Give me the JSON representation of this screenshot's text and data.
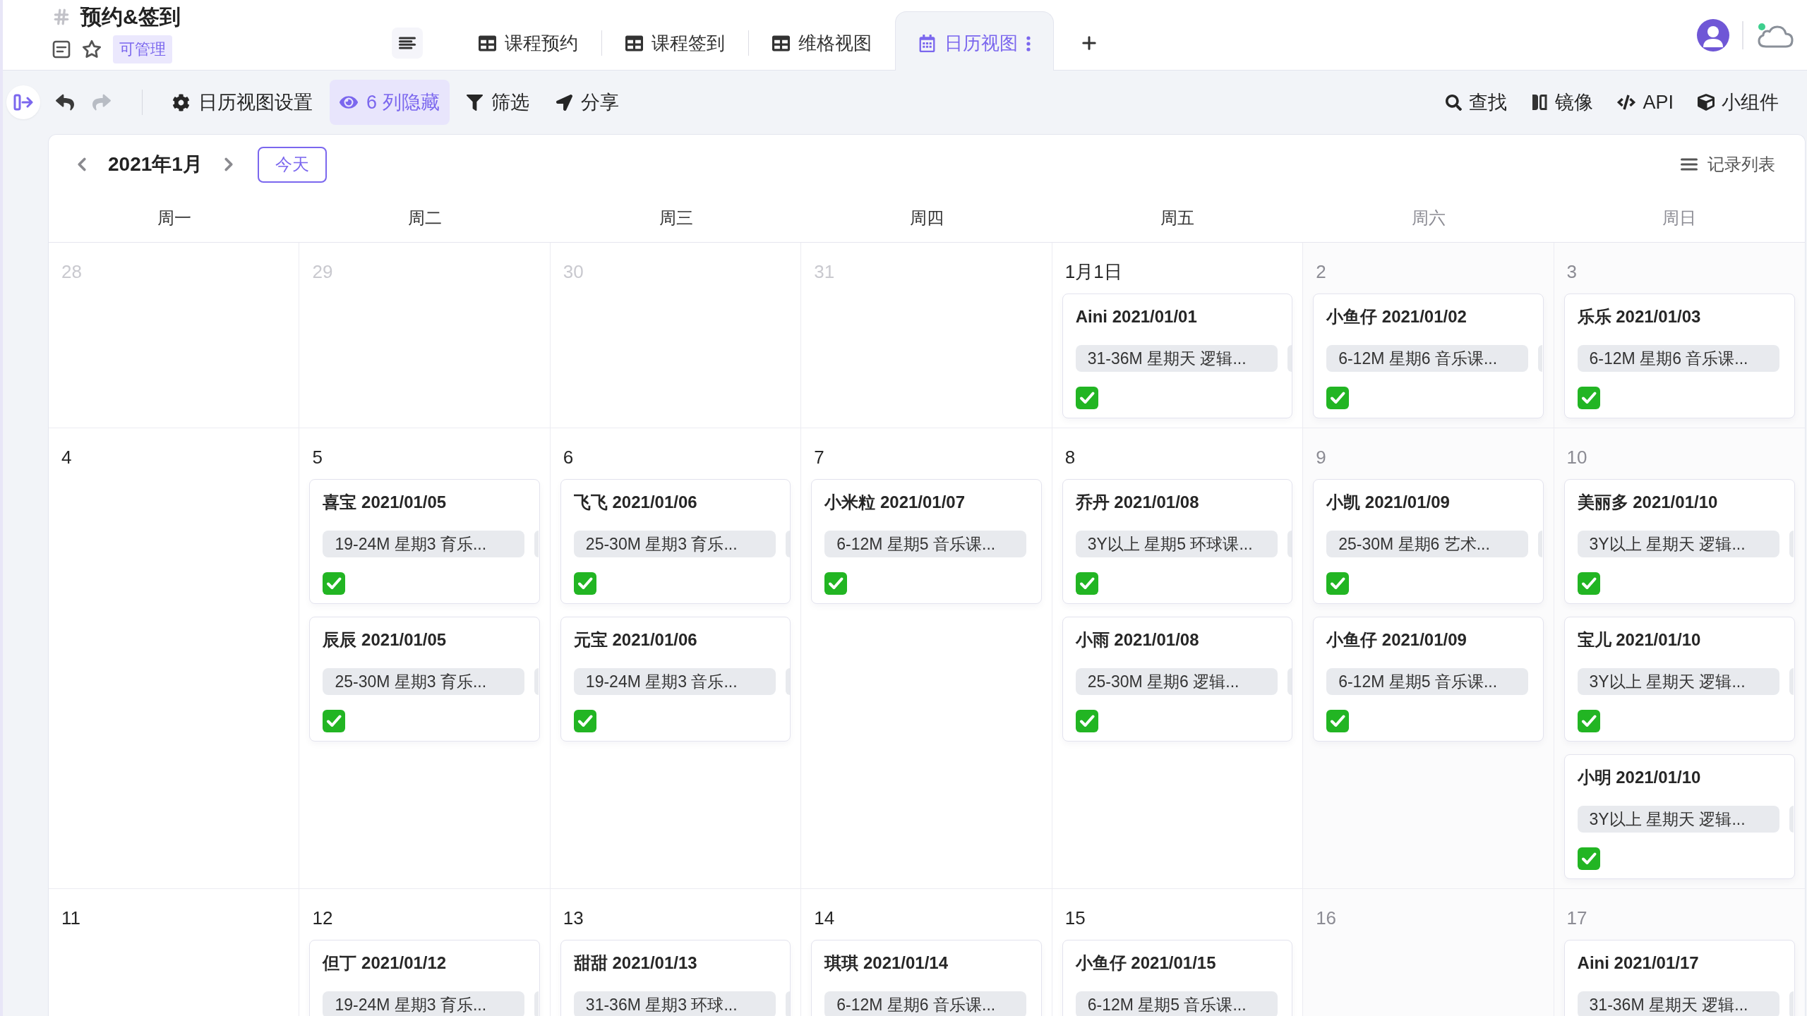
{
  "header": {
    "title": "预约&签到",
    "starred": false,
    "badge": "可管理"
  },
  "tabs": [
    {
      "label": "课程预约",
      "kind": "grid",
      "selected": false
    },
    {
      "label": "课程签到",
      "kind": "grid",
      "selected": false
    },
    {
      "label": "维格视图",
      "kind": "grid",
      "selected": false
    },
    {
      "label": "日历视图",
      "kind": "calendar",
      "selected": true
    }
  ],
  "toolbar": {
    "history": [
      {
        "kind": "undo",
        "disabled": false
      },
      {
        "kind": "redo",
        "disabled": true
      }
    ],
    "tools": [
      {
        "label": "日历视图设置",
        "kind": "settings",
        "active": false
      },
      {
        "label": "6 列隐藏",
        "kind": "hidden_columns",
        "active": true
      },
      {
        "label": "筛选",
        "kind": "filter",
        "active": false
      },
      {
        "label": "分享",
        "kind": "share",
        "active": false
      }
    ],
    "actions": [
      {
        "label": "查找",
        "kind": "search"
      },
      {
        "label": "镜像",
        "kind": "mirror"
      },
      {
        "label": "API",
        "kind": "api"
      },
      {
        "label": "小组件",
        "kind": "widget"
      }
    ]
  },
  "calendar": {
    "month": "2021年1月",
    "today_button": "今天",
    "record_list": "记录列表",
    "weekdays": [
      {
        "label": "周一",
        "weekend": false
      },
      {
        "label": "周二",
        "weekend": false
      },
      {
        "label": "周三",
        "weekend": false
      },
      {
        "label": "周四",
        "weekend": false
      },
      {
        "label": "周五",
        "weekend": false
      },
      {
        "label": "周六",
        "weekend": true
      },
      {
        "label": "周日",
        "weekend": true
      }
    ],
    "weeks": [
      {
        "days": [
          {
            "label": "28",
            "in_month": false
          },
          {
            "label": "29",
            "in_month": false
          },
          {
            "label": "30",
            "in_month": false
          },
          {
            "label": "31",
            "in_month": false
          },
          {
            "label": "1月1日",
            "in_month": true,
            "events": [
              {
                "title": "Aini 2021/01/01",
                "tag": "31-36M 星期天 逻辑...",
                "more_tags": true,
                "checked": true
              }
            ]
          },
          {
            "label": "2",
            "in_month": true,
            "events": [
              {
                "title": "小鱼仔 2021/01/02",
                "tag": "6-12M 星期6 音乐课...",
                "more_tags": true,
                "checked": true
              }
            ]
          },
          {
            "label": "3",
            "in_month": true,
            "events": [
              {
                "title": "乐乐 2021/01/03",
                "tag": "6-12M 星期6 音乐课...",
                "more_tags": false,
                "checked": true
              }
            ]
          }
        ]
      },
      {
        "days": [
          {
            "label": "4",
            "in_month": true
          },
          {
            "label": "5",
            "in_month": true,
            "events": [
              {
                "title": "喜宝 2021/01/05",
                "tag": "19-24M 星期3 育乐...",
                "more_tags": true,
                "checked": true
              },
              {
                "title": "辰辰 2021/01/05",
                "tag": "25-30M 星期3 育乐...",
                "more_tags": true,
                "checked": true
              }
            ]
          },
          {
            "label": "6",
            "in_month": true,
            "events": [
              {
                "title": "飞飞 2021/01/06",
                "tag": "25-30M 星期3 育乐...",
                "more_tags": true,
                "checked": true
              },
              {
                "title": "元宝 2021/01/06",
                "tag": "19-24M 星期3 音乐...",
                "more_tags": true,
                "checked": true
              }
            ]
          },
          {
            "label": "7",
            "in_month": true,
            "events": [
              {
                "title": "小米粒 2021/01/07",
                "tag": "6-12M 星期5 音乐课...",
                "more_tags": false,
                "checked": true
              }
            ]
          },
          {
            "label": "8",
            "in_month": true,
            "events": [
              {
                "title": "乔丹 2021/01/08",
                "tag": "3Y以上 星期5 环球课...",
                "more_tags": true,
                "checked": true
              },
              {
                "title": "小雨 2021/01/08",
                "tag": "25-30M 星期6 逻辑...",
                "more_tags": true,
                "checked": true
              }
            ]
          },
          {
            "label": "9",
            "in_month": true,
            "events": [
              {
                "title": "小凯 2021/01/09",
                "tag": "25-30M 星期6 艺术...",
                "more_tags": true,
                "checked": true
              },
              {
                "title": "小鱼仔 2021/01/09",
                "tag": "6-12M 星期5 音乐课...",
                "more_tags": false,
                "checked": true
              }
            ]
          },
          {
            "label": "10",
            "in_month": true,
            "events": [
              {
                "title": "美丽多 2021/01/10",
                "tag": "3Y以上 星期天 逻辑...",
                "more_tags": true,
                "checked": true
              },
              {
                "title": "宝儿 2021/01/10",
                "tag": "3Y以上 星期天 逻辑...",
                "more_tags": true,
                "checked": true
              },
              {
                "title": "小明 2021/01/10",
                "tag": "3Y以上 星期天 逻辑...",
                "more_tags": true,
                "checked": true
              }
            ]
          }
        ]
      },
      {
        "days": [
          {
            "label": "11",
            "in_month": true
          },
          {
            "label": "12",
            "in_month": true,
            "events": [
              {
                "title": "但丁 2021/01/12",
                "tag": "19-24M 星期3 育乐...",
                "more_tags": true
              }
            ]
          },
          {
            "label": "13",
            "in_month": true,
            "events": [
              {
                "title": "甜甜 2021/01/13",
                "tag": "31-36M 星期3 环球...",
                "more_tags": true
              }
            ]
          },
          {
            "label": "14",
            "in_month": true,
            "events": [
              {
                "title": "琪琪 2021/01/14",
                "tag": "6-12M 星期6 音乐课...",
                "more_tags": false
              }
            ]
          },
          {
            "label": "15",
            "in_month": true,
            "events": [
              {
                "title": "小鱼仔 2021/01/15",
                "tag": "6-12M 星期5 音乐课...",
                "more_tags": false
              }
            ]
          },
          {
            "label": "16",
            "in_month": true
          },
          {
            "label": "17",
            "in_month": true,
            "events": [
              {
                "title": "Aini 2021/01/17",
                "tag": "31-36M 星期天 逻辑...",
                "more_tags": true
              }
            ]
          }
        ]
      }
    ]
  }
}
